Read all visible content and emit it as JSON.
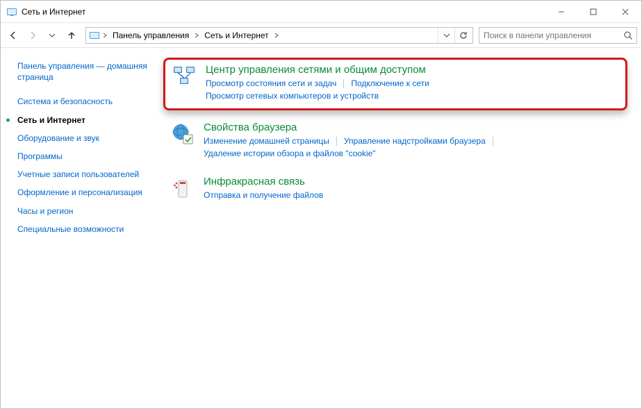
{
  "window": {
    "title": "Сеть и Интернет"
  },
  "nav": {
    "breadcrumb": {
      "items": [
        "Панель управления",
        "Сеть и Интернет"
      ]
    },
    "search_placeholder": "Поиск в панели управления"
  },
  "sidebar": {
    "home": "Панель управления — домашняя страница",
    "items": [
      {
        "label": "Система и безопасность",
        "current": false
      },
      {
        "label": "Сеть и Интернет",
        "current": true
      },
      {
        "label": "Оборудование и звук",
        "current": false
      },
      {
        "label": "Программы",
        "current": false
      },
      {
        "label": "Учетные записи пользователей",
        "current": false
      },
      {
        "label": "Оформление и персонализация",
        "current": false
      },
      {
        "label": "Часы и регион",
        "current": false
      },
      {
        "label": "Специальные возможности",
        "current": false
      }
    ]
  },
  "categories": [
    {
      "title": "Центр управления сетями и общим доступом",
      "links": [
        "Просмотр состояния сети и задач",
        "Подключение к сети",
        "Просмотр сетевых компьютеров и устройств"
      ],
      "highlight": true
    },
    {
      "title": "Свойства браузера",
      "links": [
        "Изменение домашней страницы",
        "Управление надстройками браузера",
        "Удаление истории обзора и файлов \"cookie\""
      ],
      "highlight": false
    },
    {
      "title": "Инфракрасная связь",
      "links": [
        "Отправка и получение файлов"
      ],
      "highlight": false
    }
  ]
}
